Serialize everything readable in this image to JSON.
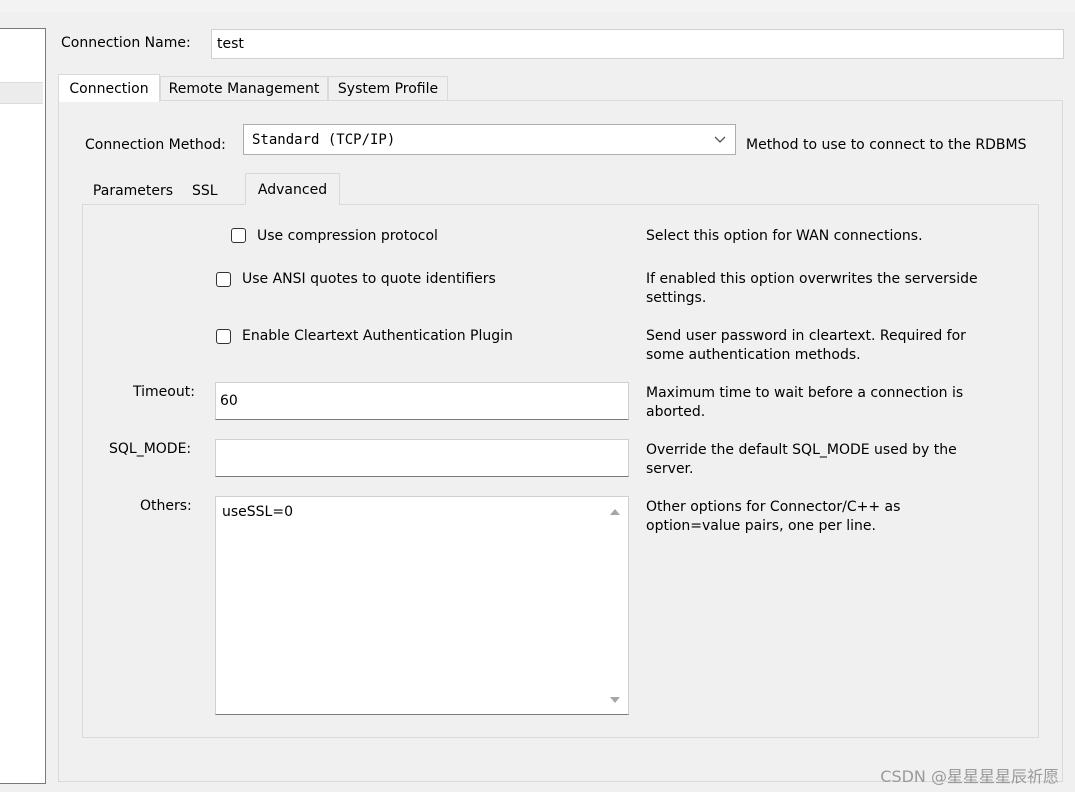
{
  "connection_name": {
    "label": "Connection Name:",
    "value": "test"
  },
  "main_tabs": [
    "Connection",
    "Remote Management",
    "System Profile"
  ],
  "connection_method": {
    "label": "Connection Method:",
    "value": "Standard (TCP/IP)",
    "description": "Method to use to connect to the RDBMS"
  },
  "sub_tabs": [
    "Parameters",
    "SSL",
    "Advanced"
  ],
  "advanced": {
    "compression": {
      "label": "Use compression protocol",
      "checked": false,
      "description": "Select this option for WAN connections."
    },
    "ansi_quotes": {
      "label": "Use ANSI quotes to quote identifiers",
      "checked": false,
      "description": "If enabled this option overwrites the serverside settings."
    },
    "cleartext": {
      "label": "Enable Cleartext Authentication Plugin",
      "checked": false,
      "description": "Send user password in cleartext. Required for some authentication methods."
    },
    "timeout": {
      "label": "Timeout:",
      "value": "60",
      "description": "Maximum time to wait before a connection is aborted."
    },
    "sql_mode": {
      "label": "SQL_MODE:",
      "value": "",
      "description": "Override the default SQL_MODE used by the server."
    },
    "others": {
      "label": "Others:",
      "value": "useSSL=0",
      "description": "Other options for Connector/C++ as option=value pairs, one per line."
    }
  },
  "watermark": "CSDN @星星星星辰祈愿",
  "icons": {
    "dropdown": "chevron-down-icon",
    "scroll_up": "scroll-up-icon",
    "scroll_down": "scroll-down-icon"
  }
}
